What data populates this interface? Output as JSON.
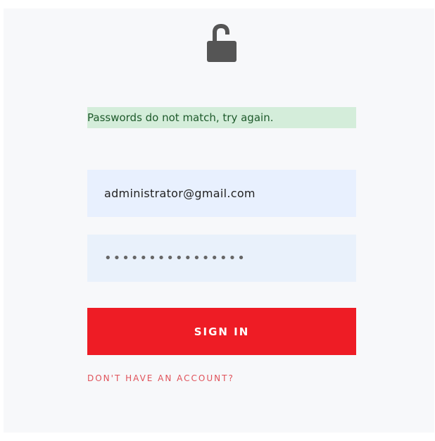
{
  "icons": {
    "lock": "unlocked-padlock-icon"
  },
  "colors": {
    "panel_bg": "#f7f8fa",
    "alert_bg": "#d4edda",
    "alert_text": "#1e5a2b",
    "primary_button": "#ee1c25",
    "link": "#e0525a",
    "input_bg": "#e8f0fe"
  },
  "alert": {
    "message": "Passwords do not match, try again."
  },
  "form": {
    "email_value": "administrator@gmail.com",
    "password_value": "••••••••••••••••",
    "submit_label": "SIGN IN",
    "account_link_label": "DON'T HAVE AN ACCOUNT?"
  }
}
